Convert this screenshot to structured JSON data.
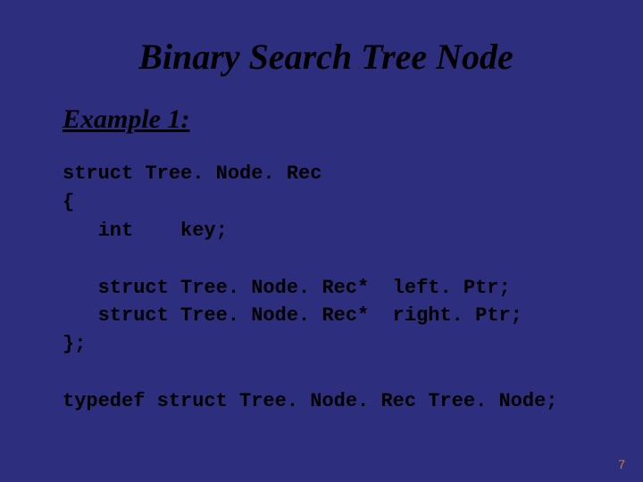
{
  "title": "Binary Search Tree Node",
  "sub": "Example 1:",
  "code": {
    "l1": "struct Tree. Node. Rec",
    "l2": "{",
    "l3": "   int    key;",
    "l4": "",
    "l5": "   struct Tree. Node. Rec*  left. Ptr;",
    "l6": "   struct Tree. Node. Rec*  right. Ptr;",
    "l7": "};",
    "l8": "",
    "l9": "typedef struct Tree. Node. Rec Tree. Node;"
  },
  "page": "7"
}
